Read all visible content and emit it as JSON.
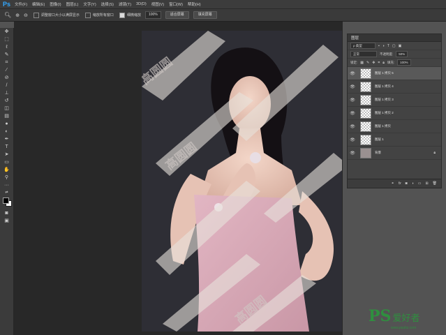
{
  "app": {
    "logo": "Ps"
  },
  "menu": [
    "文件(F)",
    "编辑(E)",
    "图像(I)",
    "图层(L)",
    "文字(Y)",
    "选择(S)",
    "滤镜(T)",
    "3D(D)",
    "视图(V)",
    "窗口(W)",
    "帮助(H)"
  ],
  "options": {
    "resize_windows_label": "调整窗口大小以满屏显示",
    "zoom_all_windows_label": "缩放所有窗口",
    "scrubby_zoom_label": "细微缩放",
    "zoom_value": "100%",
    "fit_screen_button": "适合屏幕",
    "fill_screen_button": "填充屏幕",
    "scrubby_zoom_checked": true
  },
  "layers_panel": {
    "tab": "图层",
    "filter_kind": "ρ 类型",
    "blend_mode": "正常",
    "opacity_label": "不透明度:",
    "opacity_value": "50%",
    "lock_label": "锁定:",
    "fill_label": "填充:",
    "fill_value": "100%",
    "layers": [
      {
        "name": "图层 1 拷贝 5",
        "selected": true,
        "thumb": "transparent"
      },
      {
        "name": "图层 1 拷贝 4",
        "selected": false,
        "thumb": "transparent"
      },
      {
        "name": "图层 1 拷贝 3",
        "selected": false,
        "thumb": "transparent"
      },
      {
        "name": "图层 1 拷贝 2",
        "selected": false,
        "thumb": "transparent"
      },
      {
        "name": "图层 1 拷贝",
        "selected": false,
        "thumb": "transparent"
      },
      {
        "name": "图层 1",
        "selected": false,
        "thumb": "transparent"
      },
      {
        "name": "背景",
        "selected": false,
        "thumb": "photo",
        "locked": true
      }
    ]
  },
  "canvas": {
    "watermark_text": "高圆圆",
    "accent_color": "#d7a4b3"
  },
  "brand": {
    "ps": "PS",
    "cn": "爱好者",
    "url": "www.psahz.com"
  },
  "colors": {
    "ui_bg": "#535353",
    "panel_bg": "#434343",
    "selected_layer": "#595959",
    "ps_blue": "#31a8ff",
    "brand_green": "#2f8f3f"
  }
}
